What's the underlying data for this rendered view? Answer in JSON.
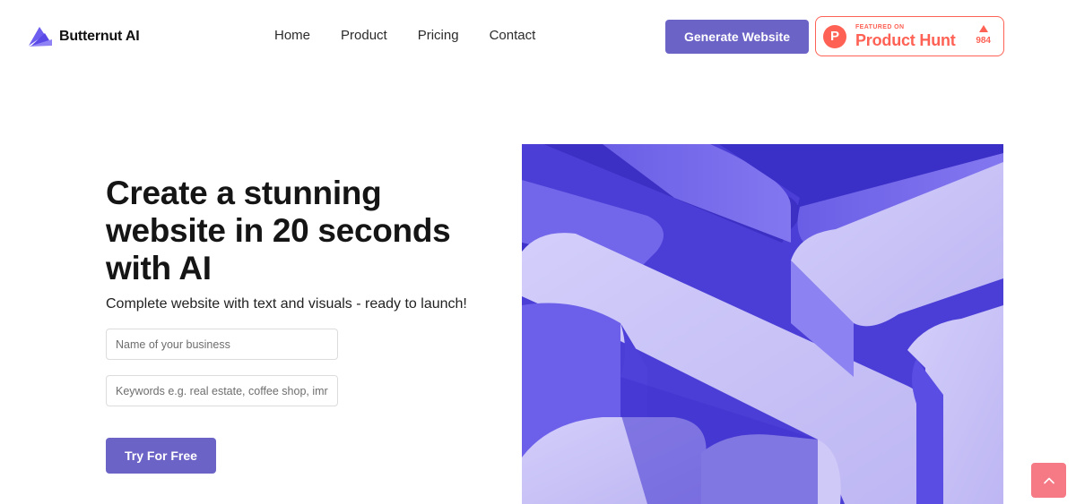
{
  "brand": {
    "name": "Butternut AI",
    "logo_icon": "layered-wing-logo-icon"
  },
  "nav": {
    "items": [
      {
        "label": "Home"
      },
      {
        "label": "Product"
      },
      {
        "label": "Pricing"
      },
      {
        "label": "Contact"
      }
    ]
  },
  "header": {
    "cta_label": "Generate Website",
    "product_hunt": {
      "featured_label": "FEATURED ON",
      "name": "Product Hunt",
      "logo_letter": "P",
      "votes": "984",
      "color": "#ff6154"
    }
  },
  "hero": {
    "title": "Create a stunning website in 20 seconds with AI",
    "subtitle": "Complete website with text and visuals - ready to launch!",
    "business_placeholder": "Name of your business",
    "keywords_placeholder": "Keywords e.g. real estate, coffee shop, imr",
    "cta_label": "Try For Free",
    "image_icon": "abstract-3d-purple-blocks-image"
  },
  "scroll_top": {
    "icon": "chevron-up-icon"
  },
  "colors": {
    "accent": "#6b63c6",
    "hero_dark": "#4b40d8",
    "hero_light": "#c7c1f5",
    "scroll_top": "#f67a86"
  }
}
